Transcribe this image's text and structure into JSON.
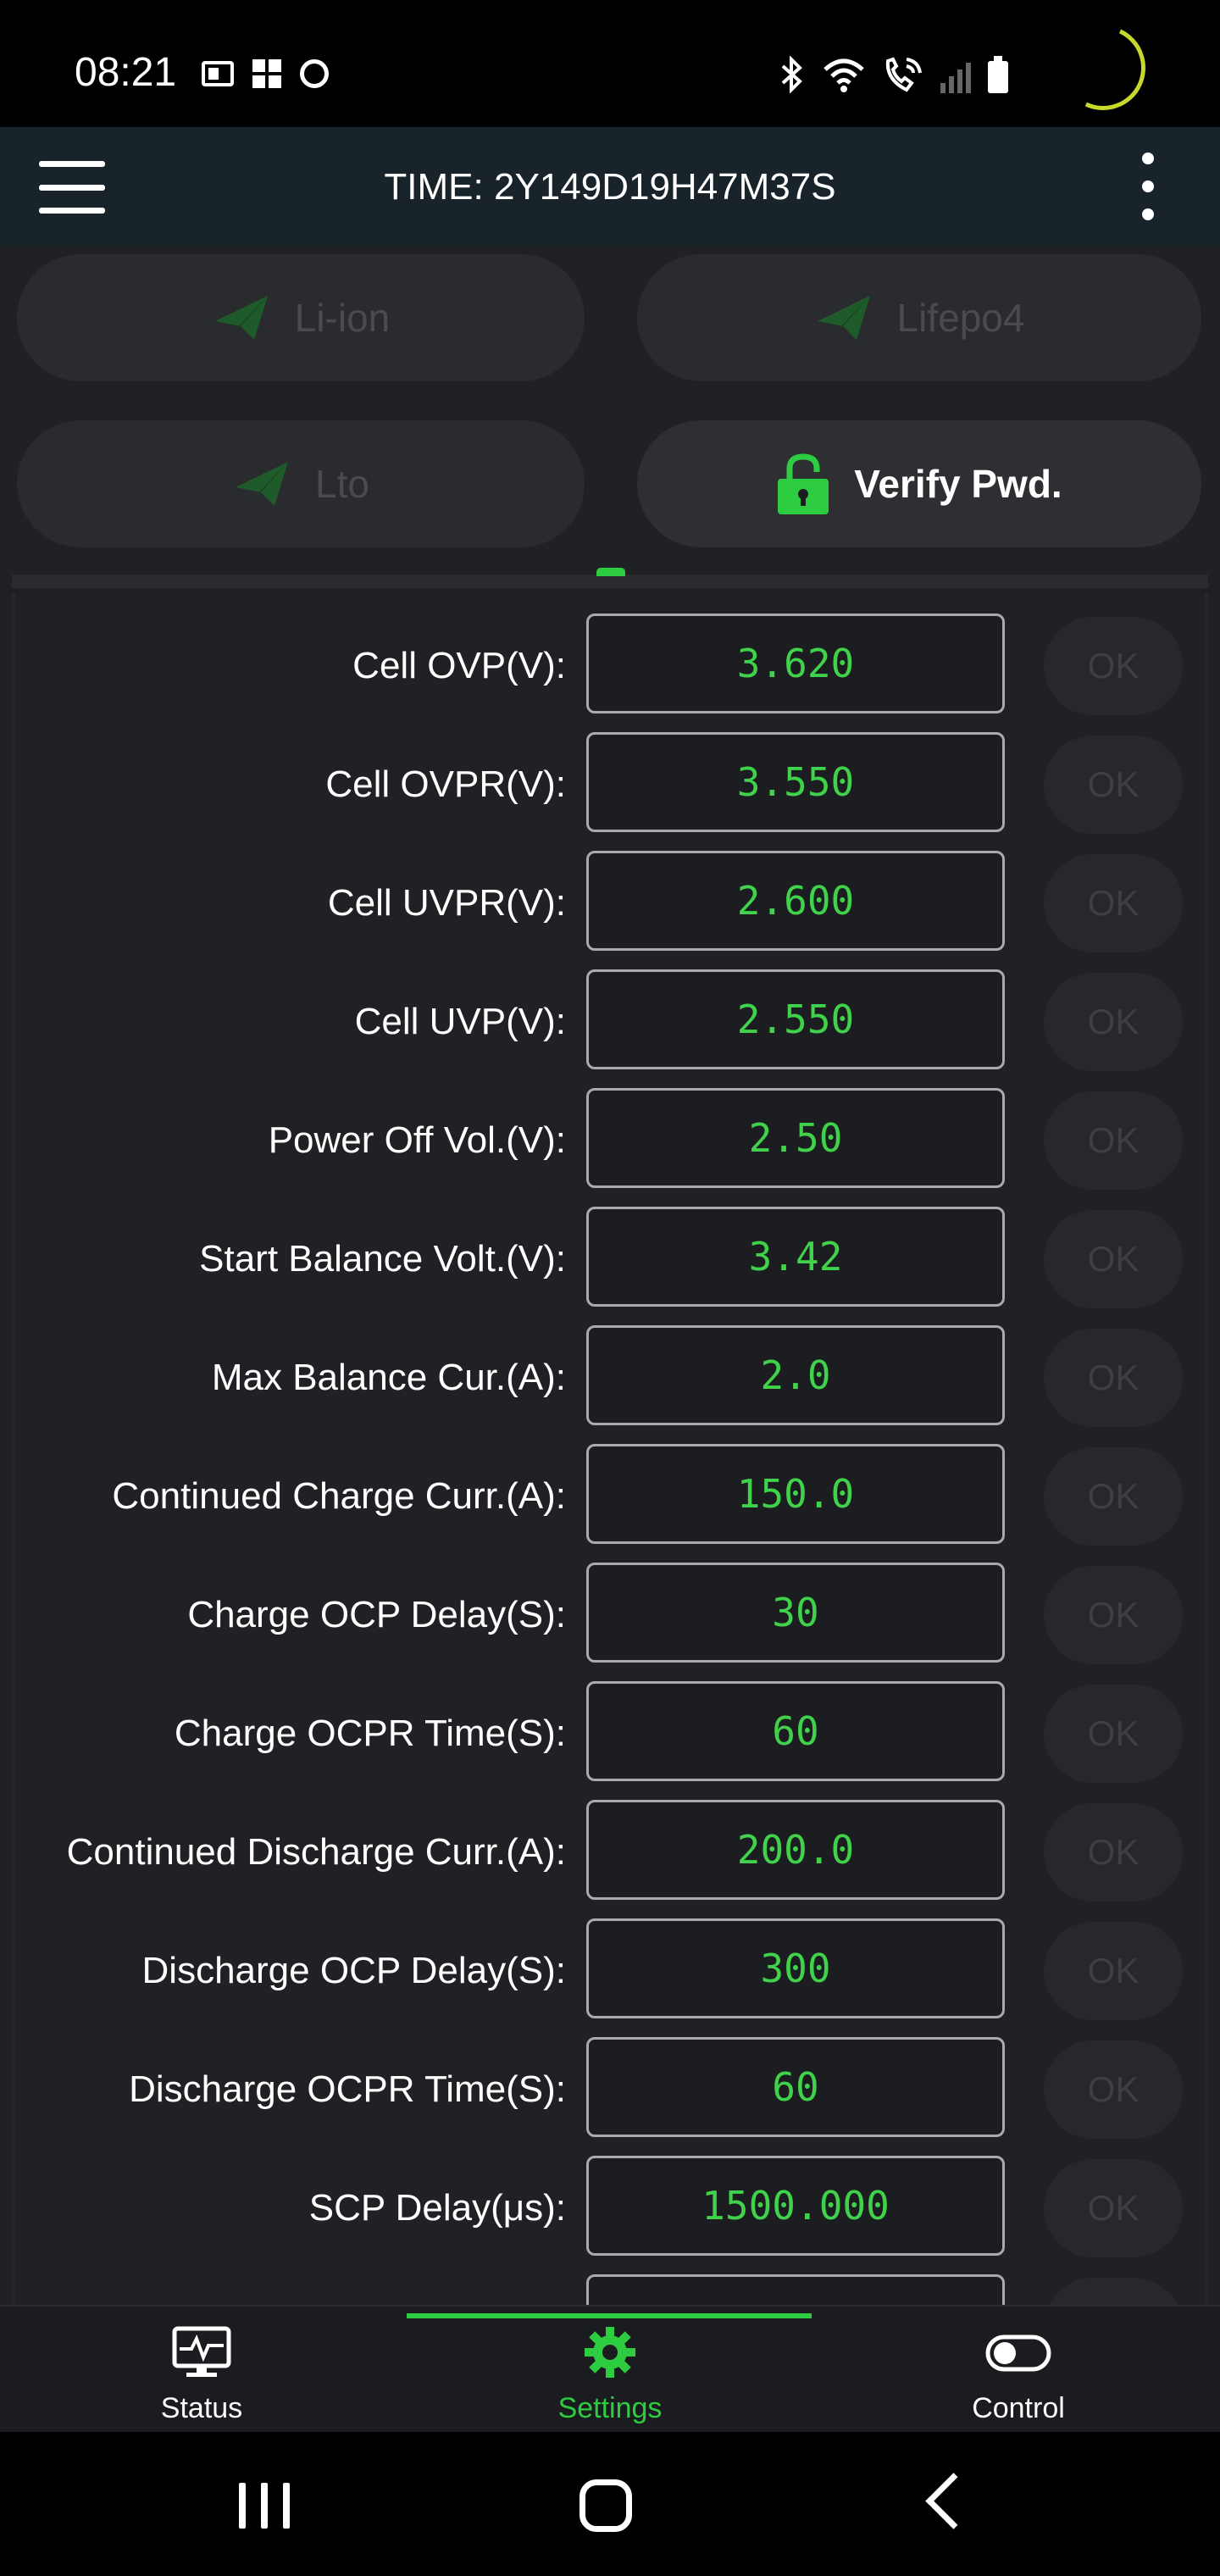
{
  "status_bar": {
    "time": "08:21",
    "left_icons": [
      "card-icon",
      "grid-icon",
      "circle-icon"
    ],
    "right_icons": [
      "bluetooth-icon",
      "wifi-icon",
      "call-icon",
      "signal-icon",
      "battery-icon"
    ]
  },
  "app_bar": {
    "title": "TIME: 2Y149D19H47M37S",
    "menu_icon": "hamburger-menu-icon",
    "more_icon": "more-vert-icon"
  },
  "presets": {
    "li_ion": "Li-ion",
    "lifepo4": "Lifepo4",
    "lto": "Lto",
    "verify": "Verify Pwd."
  },
  "settings": [
    {
      "label": "Cell OVP(V):",
      "value": "3.620",
      "action": "OK"
    },
    {
      "label": "Cell OVPR(V):",
      "value": "3.550",
      "action": "OK"
    },
    {
      "label": "Cell UVPR(V):",
      "value": "2.600",
      "action": "OK"
    },
    {
      "label": "Cell UVP(V):",
      "value": "2.550",
      "action": "OK"
    },
    {
      "label": "Power Off Vol.(V):",
      "value": "2.50",
      "action": "OK"
    },
    {
      "label": "Start Balance Volt.(V):",
      "value": "3.42",
      "action": "OK"
    },
    {
      "label": "Max Balance Cur.(A):",
      "value": "2.0",
      "action": "OK"
    },
    {
      "label": "Continued Charge Curr.(A):",
      "value": "150.0",
      "action": "OK"
    },
    {
      "label": "Charge OCP Delay(S):",
      "value": "30",
      "action": "OK"
    },
    {
      "label": "Charge OCPR Time(S):",
      "value": "60",
      "action": "OK"
    },
    {
      "label": "Continued Discharge Curr.(A):",
      "value": "200.0",
      "action": "OK"
    },
    {
      "label": "Discharge OCP Delay(S):",
      "value": "300",
      "action": "OK"
    },
    {
      "label": "Discharge OCPR Time(S):",
      "value": "60",
      "action": "OK"
    },
    {
      "label": "SCP Delay(μs):",
      "value": "1500.000",
      "action": "OK"
    },
    {
      "label": "",
      "value": "",
      "action": ""
    }
  ],
  "bottom_nav": {
    "items": [
      {
        "label": "Status",
        "icon": "monitor-pulse-icon",
        "active": false
      },
      {
        "label": "Settings",
        "icon": "gear-icon",
        "active": true
      },
      {
        "label": "Control",
        "icon": "toggle-icon",
        "active": false
      }
    ]
  },
  "colors": {
    "accent": "#2ecc40",
    "value_text": "#3fd24a",
    "background": "#202124",
    "app_bar": "#18232a"
  }
}
